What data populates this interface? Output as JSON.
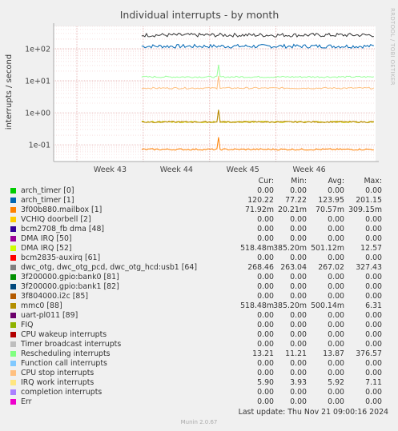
{
  "chart_data": {
    "type": "line",
    "title": "Individual interrupts - by month",
    "ylabel": "interrupts / second",
    "yscale": "log",
    "ylim": [
      0.03,
      500
    ],
    "ytick_labels": [
      "1e+02",
      "1e+01",
      "1e+00",
      "1e-01"
    ],
    "yticks": [
      100,
      10,
      1,
      0.1
    ],
    "x_categories": [
      "Week 43",
      "Week 44",
      "Week 45",
      "Week 46"
    ],
    "grid": true,
    "series": [
      {
        "name": "arch_timer [1]",
        "color": "#0066b3",
        "level": 120
      },
      {
        "name": "dwc_otg, dwc_otg_pcd, dwc_otg_hcd:usb1 [64]",
        "color": "#333333",
        "level": 268
      },
      {
        "name": "Rescheduling interrupts",
        "color": "#99ff99",
        "level": 13.2
      },
      {
        "name": "IRQ work interrupts",
        "color": "#ffc080",
        "level": 5.9
      },
      {
        "name": "DMA IRQ [52]",
        "color": "#cccc00",
        "level": 0.518
      },
      {
        "name": "mmc0 [88]",
        "color": "#b8860b",
        "level": 0.518
      },
      {
        "name": "3f00b880.mailbox [1]",
        "color": "#ff8000",
        "level": 0.0719
      }
    ]
  },
  "legend": {
    "headers": {
      "cur": "Cur:",
      "min": "Min:",
      "avg": "Avg:",
      "max": "Max:"
    },
    "rows": [
      {
        "name": "arch_timer [0]",
        "color": "#00cc00",
        "cur": "0.00",
        "min": "0.00",
        "avg": "0.00",
        "max": "0.00"
      },
      {
        "name": "arch_timer [1]",
        "color": "#0066b3",
        "cur": "120.22",
        "min": "77.22",
        "avg": "123.95",
        "max": "201.15"
      },
      {
        "name": "3f00b880.mailbox [1]",
        "color": "#ff8000",
        "cur": "71.92m",
        "min": "20.21m",
        "avg": "70.57m",
        "max": "309.15m"
      },
      {
        "name": "VCHIQ doorbell [2]",
        "color": "#ffcc00",
        "cur": "0.00",
        "min": "0.00",
        "avg": "0.00",
        "max": "0.00"
      },
      {
        "name": "bcm2708_fb dma [48]",
        "color": "#330099",
        "cur": "0.00",
        "min": "0.00",
        "avg": "0.00",
        "max": "0.00"
      },
      {
        "name": "DMA IRQ [50]",
        "color": "#990099",
        "cur": "0.00",
        "min": "0.00",
        "avg": "0.00",
        "max": "0.00"
      },
      {
        "name": "DMA IRQ [52]",
        "color": "#ccff00",
        "cur": "518.48m",
        "min": "385.20m",
        "avg": "501.12m",
        "max": "12.57"
      },
      {
        "name": "bcm2835-auxirq [61]",
        "color": "#ff0000",
        "cur": "0.00",
        "min": "0.00",
        "avg": "0.00",
        "max": "0.00"
      },
      {
        "name": "dwc_otg, dwc_otg_pcd, dwc_otg_hcd:usb1 [64]",
        "color": "#808080",
        "cur": "268.46",
        "min": "263.04",
        "avg": "267.02",
        "max": "327.43"
      },
      {
        "name": "3f200000.gpio:bank0 [81]",
        "color": "#008f00",
        "cur": "0.00",
        "min": "0.00",
        "avg": "0.00",
        "max": "0.00"
      },
      {
        "name": "3f200000.gpio:bank1 [82]",
        "color": "#00487d",
        "cur": "0.00",
        "min": "0.00",
        "avg": "0.00",
        "max": "0.00"
      },
      {
        "name": "3f804000.i2c [85]",
        "color": "#b35a00",
        "cur": "0.00",
        "min": "0.00",
        "avg": "0.00",
        "max": "0.00"
      },
      {
        "name": "mmc0 [88]",
        "color": "#b38f00",
        "cur": "518.48m",
        "min": "385.20m",
        "avg": "500.14m",
        "max": "6.31"
      },
      {
        "name": "uart-pl011 [89]",
        "color": "#6b006b",
        "cur": "0.00",
        "min": "0.00",
        "avg": "0.00",
        "max": "0.00"
      },
      {
        "name": "FIQ",
        "color": "#8fb300",
        "cur": "0.00",
        "min": "0.00",
        "avg": "0.00",
        "max": "0.00"
      },
      {
        "name": "CPU wakeup interrupts",
        "color": "#b30000",
        "cur": "0.00",
        "min": "0.00",
        "avg": "0.00",
        "max": "0.00"
      },
      {
        "name": "Timer broadcast interrupts",
        "color": "#bebebe",
        "cur": "0.00",
        "min": "0.00",
        "avg": "0.00",
        "max": "0.00"
      },
      {
        "name": "Rescheduling interrupts",
        "color": "#80ff80",
        "cur": "13.21",
        "min": "11.21",
        "avg": "13.87",
        "max": "376.57"
      },
      {
        "name": "Function call interrupts",
        "color": "#80c9ff",
        "cur": "0.00",
        "min": "0.00",
        "avg": "0.00",
        "max": "0.00"
      },
      {
        "name": "CPU stop interrupts",
        "color": "#ffc080",
        "cur": "0.00",
        "min": "0.00",
        "avg": "0.00",
        "max": "0.00"
      },
      {
        "name": "IRQ work interrupts",
        "color": "#ffe680",
        "cur": "5.90",
        "min": "3.93",
        "avg": "5.92",
        "max": "7.11"
      },
      {
        "name": "completion interrupts",
        "color": "#aa80ff",
        "cur": "0.00",
        "min": "0.00",
        "avg": "0.00",
        "max": "0.00"
      },
      {
        "name": "Err",
        "color": "#ee00cc",
        "cur": "0.00",
        "min": "0.00",
        "avg": "0.00",
        "max": "0.00"
      }
    ]
  },
  "footer": {
    "last_update": "Last update: Thu Nov 21 09:00:16 2024",
    "version": "Munin 2.0.67"
  },
  "side_text": "RRDTOOL / TOBI OETIKER"
}
